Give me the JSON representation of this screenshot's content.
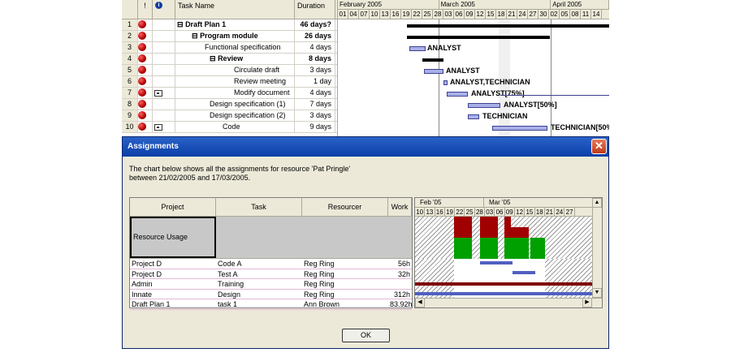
{
  "grid": {
    "headers": {
      "info_icon": "info-icon",
      "task_name": "Task Name",
      "duration": "Duration"
    },
    "rows": [
      {
        "num": "1",
        "name": "Draft Plan 1",
        "prefix": "⊟",
        "duration": "46 days?",
        "bold": true,
        "indent": 0,
        "note": false
      },
      {
        "num": "2",
        "name": "Program module",
        "prefix": "⊟",
        "duration": "26 days",
        "bold": true,
        "indent": 18,
        "note": false
      },
      {
        "num": "3",
        "name": "Functional specification",
        "prefix": "",
        "duration": "4 days",
        "bold": false,
        "indent": 34,
        "note": false
      },
      {
        "num": "4",
        "name": "Review",
        "prefix": "⊟",
        "duration": "8 days",
        "bold": true,
        "indent": 40,
        "note": false
      },
      {
        "num": "5",
        "name": "Circulate draft",
        "prefix": "",
        "duration": "3 days",
        "bold": false,
        "indent": 70,
        "note": false
      },
      {
        "num": "6",
        "name": "Review meeting",
        "prefix": "",
        "duration": "1 day",
        "bold": false,
        "indent": 70,
        "note": false
      },
      {
        "num": "7",
        "name": "Modify document",
        "prefix": "",
        "duration": "4 days",
        "bold": false,
        "indent": 70,
        "note": true
      },
      {
        "num": "8",
        "name": "Design specification (1)",
        "prefix": "",
        "duration": "7 days",
        "bold": false,
        "indent": 40,
        "note": false
      },
      {
        "num": "9",
        "name": "Design specification (2)",
        "prefix": "",
        "duration": "3 days",
        "bold": false,
        "indent": 40,
        "note": false
      },
      {
        "num": "10",
        "name": "Code",
        "prefix": "",
        "duration": "9 days",
        "bold": false,
        "indent": 56,
        "note": true
      }
    ]
  },
  "gantt": {
    "months": [
      "February 2005",
      "March 2005",
      "April 2005"
    ],
    "days": [
      "01",
      "04",
      "07",
      "10",
      "13",
      "16",
      "19",
      "22",
      "25",
      "28",
      "03",
      "06",
      "09",
      "12",
      "15",
      "18",
      "21",
      "24",
      "27",
      "30",
      "02",
      "05",
      "08",
      "11",
      "14"
    ],
    "labels": [
      "ANALYST",
      "ANALYST",
      "ANALYST,TECHNICIAN",
      "ANALYST[75%]",
      "ANALYST[50%]",
      "TECHNICIAN",
      "TECHNICIAN[50%"
    ]
  },
  "dialog": {
    "title": "Assignments",
    "close_glyph": "✕",
    "desc_line1": "The chart below shows all the assignments for resource 'Pat Pringle'",
    "desc_line2": "between 21/02/2005 and 17/03/2005.",
    "ok_label": "OK"
  },
  "assignments": {
    "headers": {
      "project": "Project",
      "task": "Task",
      "resource": "Resourcer",
      "work": "Work"
    },
    "resource_usage_label": "Resource Usage",
    "rows": [
      {
        "project": "Project D",
        "task": "Code A",
        "resource": "Reg Ring",
        "work": "56h"
      },
      {
        "project": "Project D",
        "task": "Test A",
        "resource": "Reg Ring",
        "work": "32h"
      },
      {
        "project": "Admin",
        "task": "Training",
        "resource": "Reg Ring",
        "work": ""
      },
      {
        "project": "Innate",
        "task": "Design",
        "resource": "Reg Ring",
        "work": "312h"
      },
      {
        "project": "Draft Plan 1",
        "task": "task 1",
        "resource": "Ann Brown",
        "work": "83.92h"
      }
    ]
  },
  "usage": {
    "months": [
      "Feb '05",
      "Mar '05"
    ],
    "days": [
      "10",
      "13",
      "16",
      "19",
      "22",
      "25",
      "28",
      "03",
      "06",
      "09",
      "12",
      "15",
      "18",
      "21",
      "24",
      "27"
    ]
  },
  "colors": {
    "over_alloc": "#a00000",
    "alloc_ok": "#00a000",
    "bar_blue": "#5060c0",
    "bar_maroon": "#800000"
  }
}
